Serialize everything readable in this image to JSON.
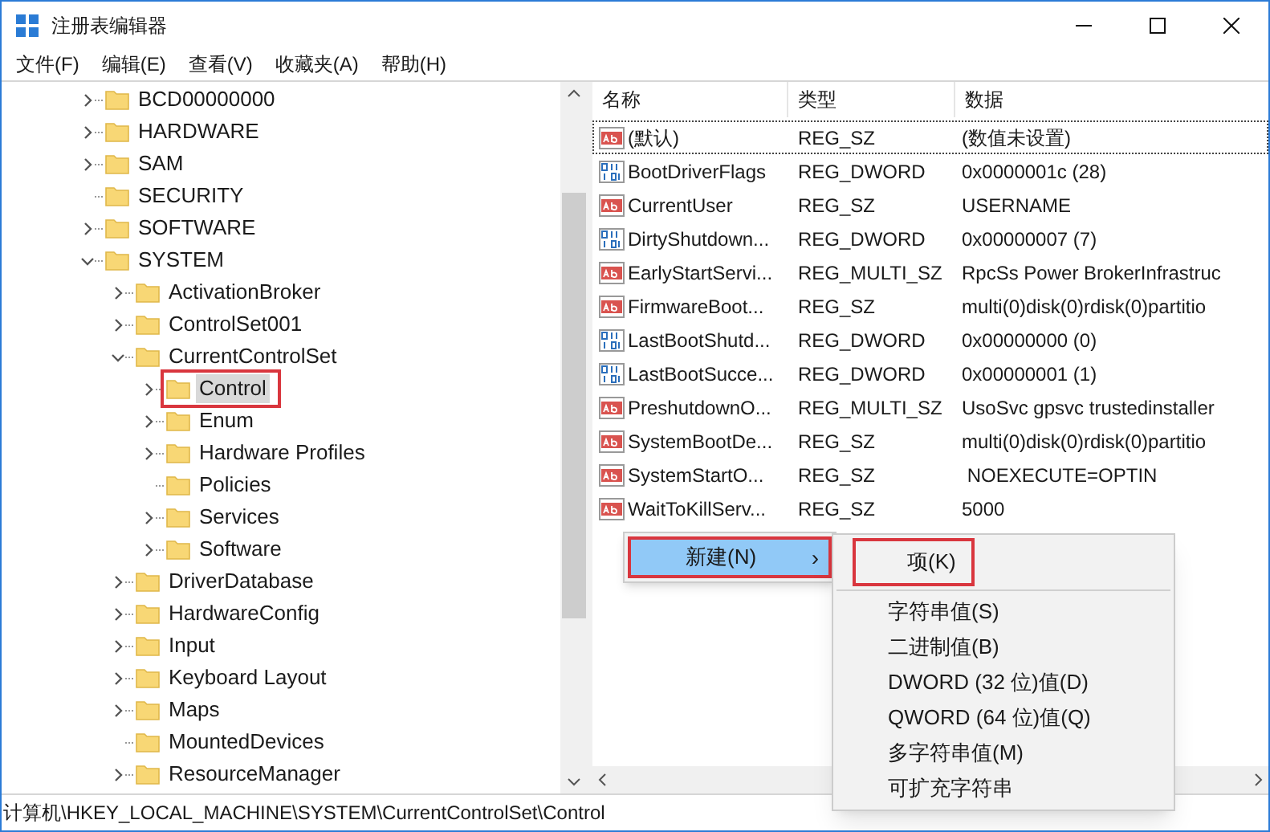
{
  "window": {
    "title": "注册表编辑器"
  },
  "menu_bar": [
    "文件(F)",
    "编辑(E)",
    "查看(V)",
    "收藏夹(A)",
    "帮助(H)"
  ],
  "tree": [
    {
      "label": "BCD00000000",
      "kind": "collapsed",
      "selected": false,
      "highlighted": false
    },
    {
      "label": "HARDWARE",
      "kind": "collapsed",
      "selected": false,
      "highlighted": false
    },
    {
      "label": "SAM",
      "kind": "collapsed",
      "selected": false,
      "highlighted": false
    },
    {
      "label": "SECURITY",
      "kind": "leaf",
      "selected": false,
      "highlighted": false
    },
    {
      "label": "SOFTWARE",
      "kind": "collapsed",
      "selected": false,
      "highlighted": false
    },
    {
      "label": "SYSTEM",
      "kind": "expanded",
      "selected": false,
      "highlighted": false,
      "children": [
        {
          "label": "ActivationBroker",
          "kind": "collapsed",
          "selected": false,
          "highlighted": false
        },
        {
          "label": "ControlSet001",
          "kind": "collapsed",
          "selected": false,
          "highlighted": false
        },
        {
          "label": "CurrentControlSet",
          "kind": "expanded",
          "selected": false,
          "highlighted": false,
          "children": [
            {
              "label": "Control",
              "kind": "collapsed",
              "selected": true,
              "highlighted": true
            },
            {
              "label": "Enum",
              "kind": "collapsed",
              "selected": false,
              "highlighted": false
            },
            {
              "label": "Hardware Profiles",
              "kind": "collapsed",
              "selected": false,
              "highlighted": false
            },
            {
              "label": "Policies",
              "kind": "leaf",
              "selected": false,
              "highlighted": false
            },
            {
              "label": "Services",
              "kind": "collapsed",
              "selected": false,
              "highlighted": false
            },
            {
              "label": "Software",
              "kind": "collapsed",
              "selected": false,
              "highlighted": false
            }
          ]
        },
        {
          "label": "DriverDatabase",
          "kind": "collapsed",
          "selected": false,
          "highlighted": false
        },
        {
          "label": "HardwareConfig",
          "kind": "collapsed",
          "selected": false,
          "highlighted": false
        },
        {
          "label": "Input",
          "kind": "collapsed",
          "selected": false,
          "highlighted": false
        },
        {
          "label": "Keyboard Layout",
          "kind": "collapsed",
          "selected": false,
          "highlighted": false
        },
        {
          "label": "Maps",
          "kind": "collapsed",
          "selected": false,
          "highlighted": false
        },
        {
          "label": "MountedDevices",
          "kind": "leaf",
          "selected": false,
          "highlighted": false
        },
        {
          "label": "ResourceManager",
          "kind": "collapsed",
          "selected": false,
          "highlighted": false
        }
      ]
    }
  ],
  "table": {
    "columns": [
      "名称",
      "类型",
      "数据"
    ],
    "rows": [
      {
        "kind": "string",
        "name": "(默认)",
        "type": "REG_SZ",
        "data": "(数值未设置)",
        "focused": true
      },
      {
        "kind": "binary",
        "name": "BootDriverFlags",
        "type": "REG_DWORD",
        "data": "0x0000001c (28)",
        "focused": false
      },
      {
        "kind": "string",
        "name": "CurrentUser",
        "type": "REG_SZ",
        "data": "USERNAME",
        "focused": false
      },
      {
        "kind": "binary",
        "name": "DirtyShutdown...",
        "type": "REG_DWORD",
        "data": "0x00000007 (7)",
        "focused": false
      },
      {
        "kind": "string",
        "name": "EarlyStartServi...",
        "type": "REG_MULTI_SZ",
        "data": "RpcSs Power BrokerInfrastruc",
        "focused": false
      },
      {
        "kind": "string",
        "name": "FirmwareBoot...",
        "type": "REG_SZ",
        "data": "multi(0)disk(0)rdisk(0)partitio",
        "focused": false
      },
      {
        "kind": "binary",
        "name": "LastBootShutd...",
        "type": "REG_DWORD",
        "data": "0x00000000 (0)",
        "focused": false
      },
      {
        "kind": "binary",
        "name": "LastBootSucce...",
        "type": "REG_DWORD",
        "data": "0x00000001 (1)",
        "focused": false
      },
      {
        "kind": "string",
        "name": "PreshutdownO...",
        "type": "REG_MULTI_SZ",
        "data": "UsoSvc gpsvc trustedinstaller",
        "focused": false
      },
      {
        "kind": "string",
        "name": "SystemBootDe...",
        "type": "REG_SZ",
        "data": "multi(0)disk(0)rdisk(0)partitio",
        "focused": false
      },
      {
        "kind": "string",
        "name": "SystemStartO...",
        "type": "REG_SZ",
        "data": " NOEXECUTE=OPTIN",
        "focused": false
      },
      {
        "kind": "string",
        "name": "WaitToKillServ...",
        "type": "REG_SZ",
        "data": "5000",
        "focused": false
      }
    ]
  },
  "context_menu": {
    "label": "新建(N)",
    "arrow": "›",
    "selected": true,
    "highlighted": true
  },
  "submenu": [
    {
      "label": "项(K)",
      "highlighted": true,
      "separator_after": true
    },
    {
      "label": "字符串值(S)",
      "highlighted": false,
      "separator_after": false
    },
    {
      "label": "二进制值(B)",
      "highlighted": false,
      "separator_after": false
    },
    {
      "label": "DWORD (32 位)值(D)",
      "highlighted": false,
      "separator_after": false
    },
    {
      "label": "QWORD (64 位)值(Q)",
      "highlighted": false,
      "separator_after": false
    },
    {
      "label": "多字符串值(M)",
      "highlighted": false,
      "separator_after": false
    },
    {
      "label": "可扩充字符串",
      "highlighted": false,
      "separator_after": false
    }
  ],
  "status_bar": "计算机\\HKEY_LOCAL_MACHINE\\SYSTEM\\CurrentControlSet\\Control"
}
